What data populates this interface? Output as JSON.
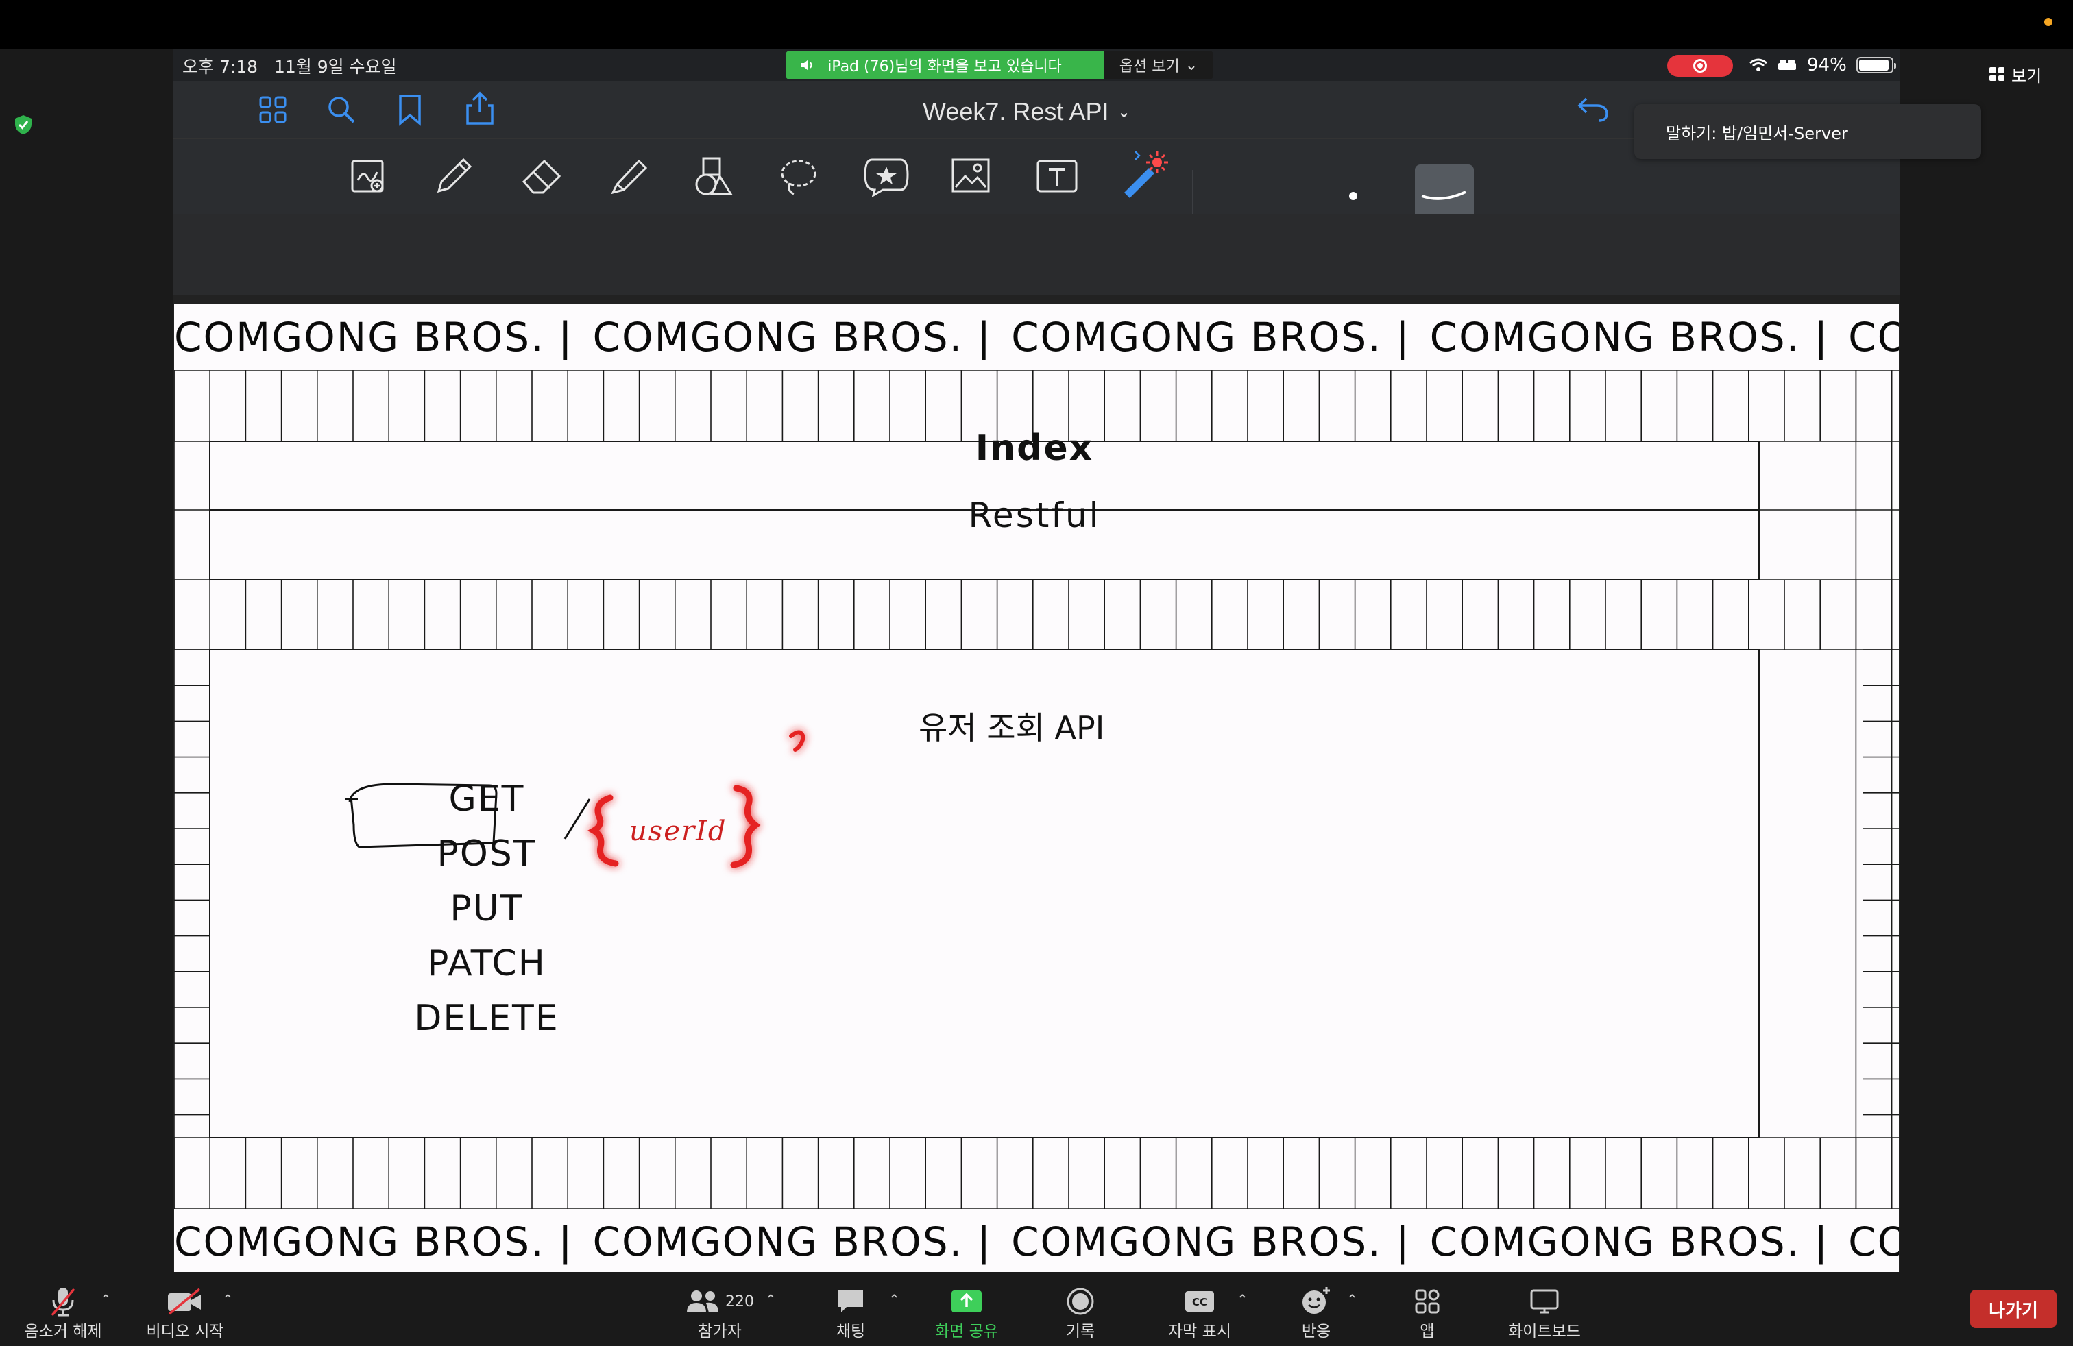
{
  "zoom": {
    "view_label": "보기",
    "speaking_prefix": "말하기: 밥/임민서-Server",
    "leave_label": "나가기",
    "toolbar": {
      "mute": "음소거 해제",
      "video": "비디오 시작",
      "participants": "참가자",
      "participants_count": "220",
      "chat": "채팅",
      "share": "화면 공유",
      "record": "기록",
      "captions": "자막 표시",
      "reactions": "반응",
      "apps": "앱",
      "whiteboard": "화이트보드"
    }
  },
  "ipad": {
    "status": {
      "time": "오후 7:18",
      "date": "11월 9일 수요일",
      "battery": "94%",
      "battery_level": 0.94
    },
    "share_banner": "iPad (76)님의 화면을 보고 있습니다",
    "options": "옵션 보기",
    "doc_title": "Week7. Rest API"
  },
  "page": {
    "banner_text": "COMGONG BROS.  |",
    "index_title": "Index",
    "subtitle": "Restful",
    "heading": "유저 조회 API",
    "methods": [
      "GET",
      "POST",
      "PUT",
      "PATCH",
      "DELETE"
    ],
    "handwriting": "{userId}"
  },
  "colors": {
    "share_green": "#39b54a",
    "record_red": "#e5343c",
    "leave_red": "#c42f2b",
    "highlight_red": "#e52424"
  }
}
